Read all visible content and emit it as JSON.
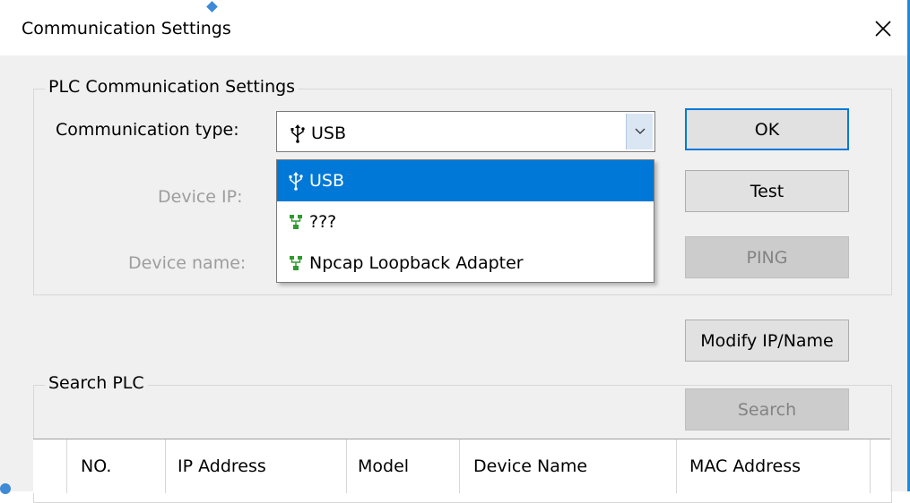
{
  "window": {
    "title": "Communication Settings",
    "close_icon": "close-icon"
  },
  "plc_group": {
    "legend": "PLC Communication Settings",
    "comm_type_label": "Communication type:",
    "comm_type_value": "USB",
    "device_ip_label": "Device IP:",
    "device_name_label": "Device name:"
  },
  "dropdown": {
    "options": [
      {
        "label": "USB",
        "icon": "usb-icon",
        "selected": true
      },
      {
        "label": "???",
        "icon": "network-adapter-icon",
        "selected": false
      },
      {
        "label": "Npcap Loopback Adapter",
        "icon": "network-adapter-icon",
        "selected": false
      }
    ]
  },
  "buttons": {
    "ok": "OK",
    "test": "Test",
    "ping": "PING",
    "modify": "Modify IP/Name",
    "search": "Search"
  },
  "search_group": {
    "legend": "Search PLC"
  },
  "table": {
    "columns": [
      "NO.",
      "IP Address",
      "Model",
      "Device Name",
      "MAC Address"
    ]
  },
  "colors": {
    "accent": "#0078d7",
    "network_icon": "#2e9b2e",
    "disabled_text": "#9d9d9d"
  }
}
